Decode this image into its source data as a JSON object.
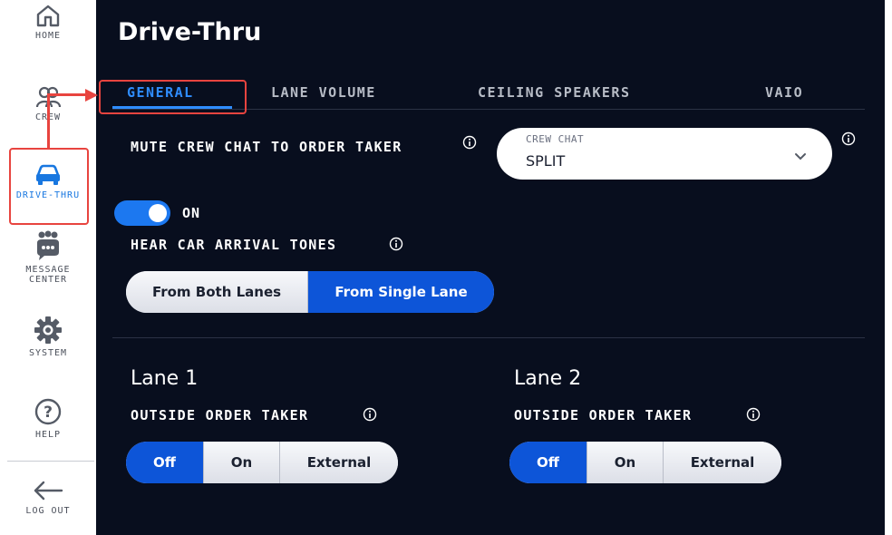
{
  "sidebar": {
    "items": [
      {
        "label": "HOME",
        "icon": "home-icon"
      },
      {
        "label": "CREW",
        "icon": "crew-icon"
      },
      {
        "label": "DRIVE-THRU",
        "icon": "car-icon",
        "active": true
      },
      {
        "label": "MESSAGE CENTER",
        "icon": "message-center-icon"
      },
      {
        "label": "SYSTEM",
        "icon": "gear-icon"
      },
      {
        "label": "HELP",
        "icon": "help-icon"
      },
      {
        "label": "LOG OUT",
        "icon": "arrow-left-icon"
      }
    ]
  },
  "header": {
    "title": "Drive-Thru"
  },
  "tabs": [
    {
      "label": "GENERAL",
      "active": true
    },
    {
      "label": "LANE VOLUME"
    },
    {
      "label": "CEILING SPEAKERS"
    },
    {
      "label": "VAIO"
    }
  ],
  "settings": {
    "mute_crew_chat": {
      "label": "MUTE CREW CHAT TO ORDER TAKER",
      "toggle_state": "ON",
      "enabled": true
    },
    "crew_chat_select": {
      "label": "CREW CHAT",
      "value": "SPLIT"
    },
    "car_arrival_tones": {
      "label": "HEAR CAR ARRIVAL TONES",
      "options": [
        "From Both Lanes",
        "From Single Lane"
      ],
      "selected": "From Single Lane"
    }
  },
  "lanes": [
    {
      "title": "Lane 1",
      "order_taker_label": "OUTSIDE ORDER TAKER",
      "options": [
        "Off",
        "On",
        "External"
      ],
      "selected": "Off"
    },
    {
      "title": "Lane 2",
      "order_taker_label": "OUTSIDE ORDER TAKER",
      "options": [
        "Off",
        "On",
        "External"
      ],
      "selected": "Off"
    }
  ],
  "colors": {
    "panel_bg": "#080e1e",
    "accent": "#2f8dff",
    "selected_segment": "#0d55d8",
    "toggle_on": "#1c78f0",
    "annotation": "#e8443f"
  }
}
